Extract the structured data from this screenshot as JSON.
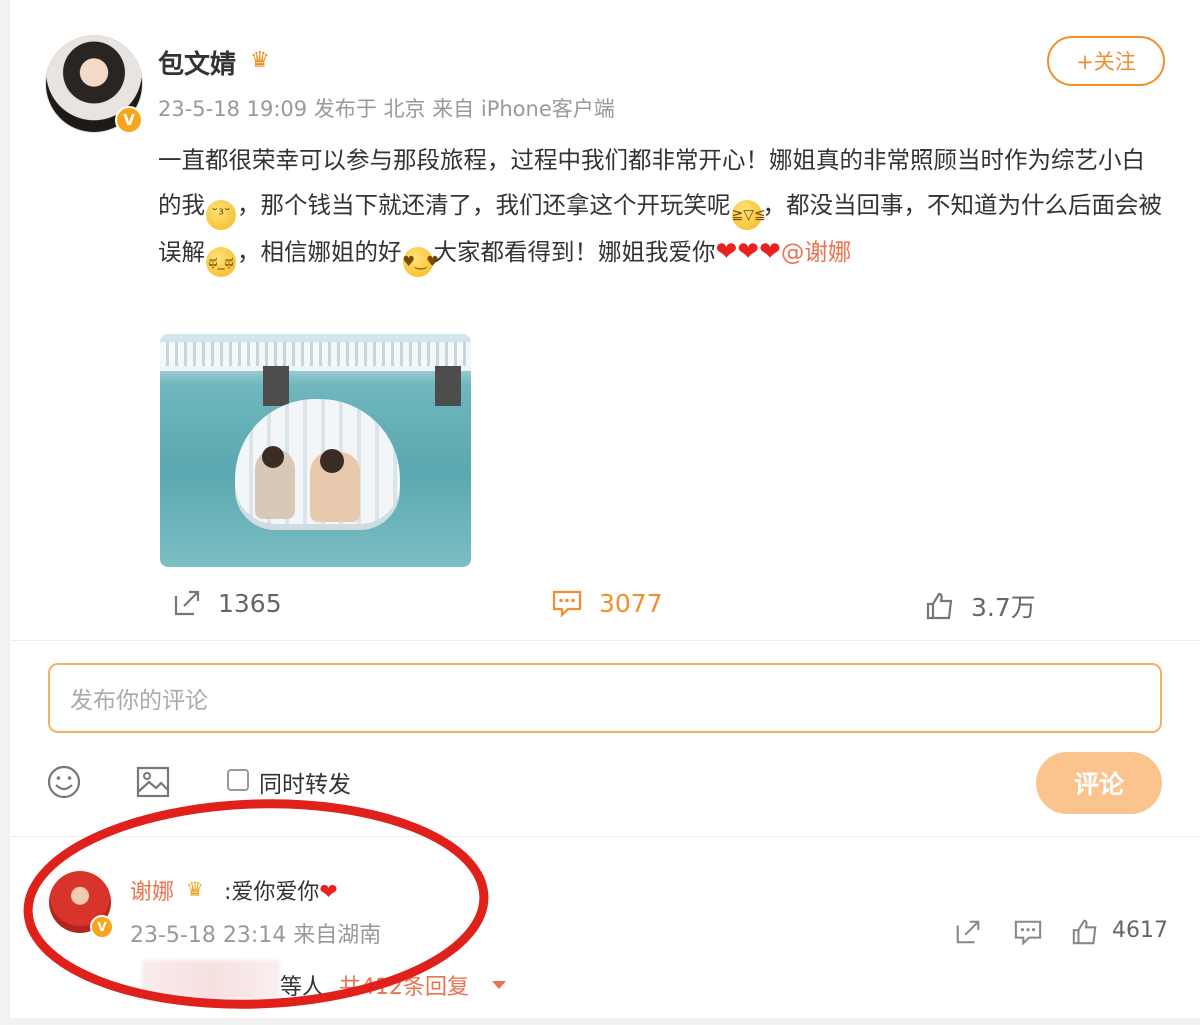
{
  "post": {
    "author": "包文婧",
    "author_badge_icon": "crown-icon",
    "meta": "23-5-18 19:09 发布于 北京 来自 iPhone客户端",
    "follow_label": "+关注",
    "text": {
      "seg1": "一直都很荣幸可以参与那段旅程，过程中我们都非常开心！娜姐真的非常照顾当时作为综艺小白的我",
      "seg2": "，那个钱当下就还清了，我们还拿这个开玩笑呢",
      "seg3": "，都没当回事，不知道为什么后面会被误解",
      "seg4": "，相信娜姐的好",
      "seg5": "大家都看得到！娜姐我爱你",
      "mention": "@谢娜"
    },
    "image_alt": "two women on an inflatable shell float in the sea",
    "actions": {
      "repost_count": "1365",
      "comment_count": "3077",
      "like_count": "3.7万"
    }
  },
  "composer": {
    "placeholder": "发布你的评论",
    "repost_label": "同时转发",
    "submit_label": "评论"
  },
  "comment": {
    "author": "谢娜",
    "text": ":爱你爱你",
    "meta": "23-5-18 23:14 来自湖南",
    "like_count": "4617",
    "replies_prefix": "等人",
    "replies_link": "共412条回复"
  },
  "colors": {
    "accent": "#f28e2c",
    "link": "#eb7350",
    "annotation": "#e0201b",
    "heart": "#e8231f"
  }
}
